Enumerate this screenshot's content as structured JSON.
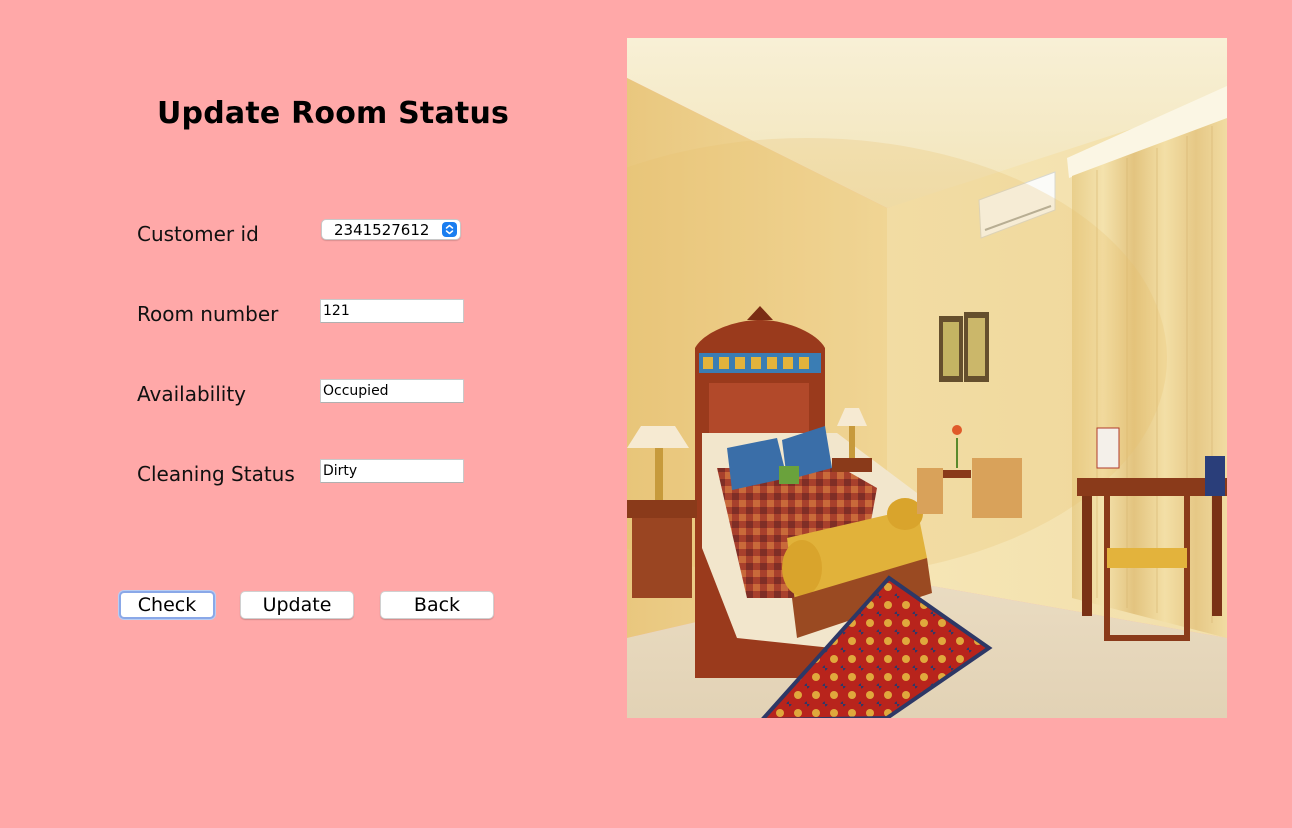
{
  "form": {
    "title": "Update Room Status",
    "customer_id_label": "Customer id",
    "customer_id_value": "2341527612",
    "room_number_label": "Room number",
    "room_number_value": "121",
    "availability_label": "Availability",
    "availability_value": "Occupied",
    "cleaning_status_label": "Cleaning Status",
    "cleaning_status_value": "Dirty"
  },
  "buttons": {
    "check": "Check",
    "update": "Update",
    "back": "Back"
  },
  "colors": {
    "background": "#ffa8a8",
    "select_arrow": "#1a7df0",
    "focus_ring": "#8aa8e8"
  },
  "image": {
    "subject": "hotel-room-photo"
  }
}
